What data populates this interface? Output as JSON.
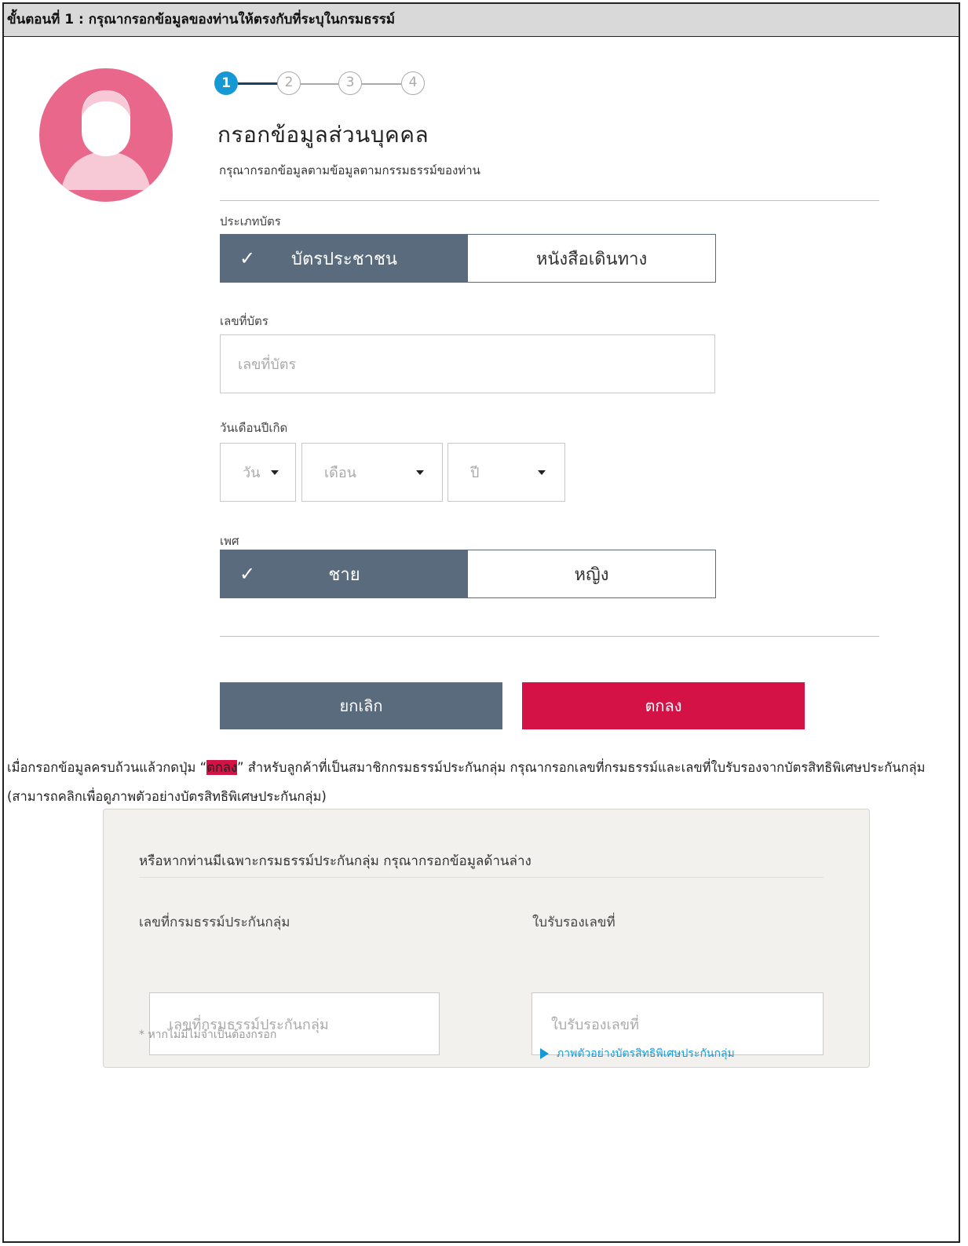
{
  "header": {
    "title": "ขั้นตอนที่ 1 : กรุณากรอกข้อมูลของท่านให้ตรงกับที่ระบุในกรมธรรม์"
  },
  "stepper": {
    "steps": [
      "1",
      "2",
      "3",
      "4"
    ],
    "current": 1
  },
  "form": {
    "title": "กรอกข้อมูลส่วนบุคคล",
    "subtitle": "กรุณากรอกข้อมูลตามข้อมูลตามกรรมธรรม์ของท่าน",
    "card_type": {
      "label": "ประเภทบัตร",
      "options": [
        "บัตรประชาชน",
        "หนังสือเดินทาง"
      ],
      "selected": "บัตรประชาชน"
    },
    "card_number": {
      "label": "เลขที่บัตร",
      "placeholder": "เลขที่บัตร"
    },
    "birthdate": {
      "label": "วันเดือนปีเกิด",
      "day": "วัน",
      "month": "เดือน",
      "year": "ปี"
    },
    "gender": {
      "label": "เพศ",
      "options": [
        "ชาย",
        "หญิง"
      ],
      "selected": "ชาย"
    },
    "buttons": {
      "cancel": "ยกเลิก",
      "ok": "ตกลง"
    }
  },
  "instruction": {
    "before": "เมื่อกรอกข้อมูลครบถ้วนแล้วกดปุ่ม “",
    "highlight": "ตกลง",
    "after": "” สำหรับลูกค้าที่เป็นสมาชิกกรมธรรม์ประกันกลุ่ม กรุณากรอกเลขที่กรมธรรม์และเลขที่ใบรับรองจากบัตรสิทธิพิเศษประกันกลุ่ม (สามารถคลิกเพื่อดูภาพตัวอย่างบัตรสิทธิพิเศษประกันกลุ่ม)"
  },
  "group_panel": {
    "title": "หรือหากท่านมีเฉพาะกรมธรรม์ประกันกลุ่ม กรุณากรอกข้อมูลด้านล่าง",
    "policy_label": "เลขที่กรมธรรม์ประกันกลุ่ม",
    "policy_placeholder": "เลขที่กรมธรรม์ประกันกลุ่ม",
    "cert_label": "ใบรับรองเลขที่",
    "cert_placeholder": "ใบรับรองเลขที่",
    "note": "* หากไม่มีไม่จำเป็นต้องกรอก",
    "link": "ภาพตัวอย่างบัตรสิทธิพิเศษประกันกลุ่ม"
  },
  "colors": {
    "accent_blue": "#1598d4",
    "slate": "#5a6b7d",
    "brand_red": "#d41245",
    "avatar_pink": "#e8678a"
  }
}
